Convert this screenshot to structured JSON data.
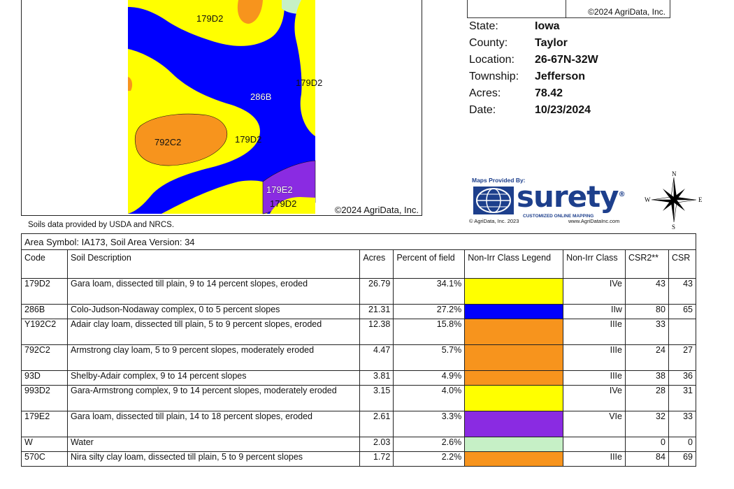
{
  "map": {
    "labels": {
      "l179d2_top": "179D2",
      "l179d2_right": "179D2",
      "l286b": "286B",
      "l792c2": "792C2",
      "l179d2_mid": "179D2",
      "l179e2": "179E2",
      "l179d2_bottom": "179D2"
    },
    "copyright": "©2024 AgriData, Inc.",
    "note": "Soils data provided by USDA and NRCS.",
    "colors": {
      "yellow": "#FFFF00",
      "blue": "#0000FF",
      "orange": "#F7941D",
      "purple": "#8A2BE2",
      "light_green": "#C6F0C6"
    }
  },
  "info": {
    "copyright": "©2024 AgriData, Inc.",
    "rows": [
      {
        "key": "State:",
        "value": "Iowa"
      },
      {
        "key": "County:",
        "value": "Taylor"
      },
      {
        "key": "Location:",
        "value": "26-67N-32W"
      },
      {
        "key": "Township:",
        "value": "Jefferson"
      },
      {
        "key": "Acres:",
        "value": "78.42"
      },
      {
        "key": "Date:",
        "value": "10/23/2024"
      }
    ]
  },
  "logo": {
    "provided_by": "Maps Provided By:",
    "word": "surety",
    "reg": "®",
    "tagline": "CUSTOMIZED ONLINE MAPPING",
    "copyright": "© AgriData, Inc. 2023",
    "url": "www.AgriDataInc.com"
  },
  "compass": {
    "n": "N",
    "s": "S",
    "e": "E",
    "w": "W"
  },
  "table": {
    "area_symbol": "Area Symbol: IA173, Soil Area Version: 34",
    "headers": {
      "code": "Code",
      "description": "Soil Description",
      "acres": "Acres",
      "percent": "Percent of field",
      "legend": "Non-Irr Class Legend",
      "class": "Non-Irr Class",
      "csr2": "CSR2**",
      "csr": "CSR"
    },
    "rows": [
      {
        "code": "179D2",
        "description": "Gara loam, dissected till plain, 9 to 14 percent slopes, eroded",
        "acres": "26.79",
        "percent": "34.1%",
        "color": "#FFFF00",
        "class": "IVe",
        "csr2": "43",
        "csr": "43"
      },
      {
        "code": "286B",
        "description": "Colo-Judson-Nodaway complex, 0 to 5 percent slopes",
        "acres": "21.31",
        "percent": "27.2%",
        "color": "#0000FF",
        "class": "IIw",
        "csr2": "80",
        "csr": "65"
      },
      {
        "code": "Y192C2",
        "description": "Adair clay loam, dissected till plain, 5 to 9 percent slopes, eroded",
        "acres": "12.38",
        "percent": "15.8%",
        "color": "#F7941D",
        "class": "IIIe",
        "csr2": "33",
        "csr": ""
      },
      {
        "code": "792C2",
        "description": "Armstrong clay loam, 5 to 9 percent slopes, moderately eroded",
        "acres": "4.47",
        "percent": "5.7%",
        "color": "#F7941D",
        "class": "IIIe",
        "csr2": "24",
        "csr": "27"
      },
      {
        "code": "93D",
        "description": "Shelby-Adair complex, 9 to 14 percent slopes",
        "acres": "3.81",
        "percent": "4.9%",
        "color": "#F7941D",
        "class": "IIIe",
        "csr2": "38",
        "csr": "36"
      },
      {
        "code": "993D2",
        "description": "Gara-Armstrong complex, 9 to 14 percent slopes, moderately eroded",
        "acres": "3.15",
        "percent": "4.0%",
        "color": "#FFFF00",
        "class": "IVe",
        "csr2": "28",
        "csr": "31"
      },
      {
        "code": "179E2",
        "description": "Gara loam, dissected till plain, 14 to 18 percent slopes, eroded",
        "acres": "2.61",
        "percent": "3.3%",
        "color": "#8A2BE2",
        "class": "VIe",
        "csr2": "32",
        "csr": "33"
      },
      {
        "code": "W",
        "description": "Water",
        "acres": "2.03",
        "percent": "2.6%",
        "color": "#C6F0C6",
        "class": "",
        "csr2": "0",
        "csr": "0"
      },
      {
        "code": "570C",
        "description": "Nira silty clay loam, dissected till plain, 5 to 9 percent slopes",
        "acres": "1.72",
        "percent": "2.2%",
        "color": "#F7941D",
        "class": "IIIe",
        "csr2": "84",
        "csr": "69"
      }
    ]
  }
}
